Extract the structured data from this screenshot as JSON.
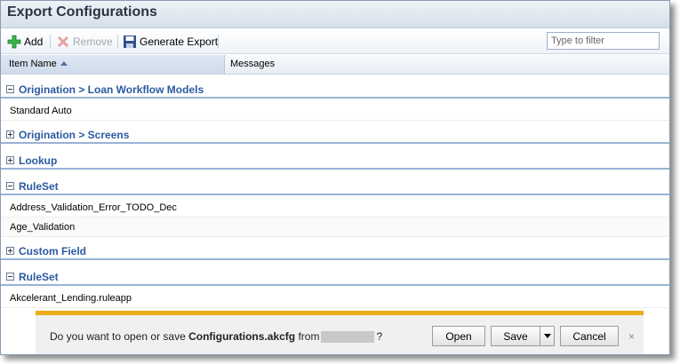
{
  "window": {
    "title": "Export Configurations"
  },
  "toolbar": {
    "add_label": "Add",
    "remove_label": "Remove",
    "generate_label": "Generate Export",
    "filter_placeholder": "Type to filter"
  },
  "columns": {
    "item_name": "Item Name",
    "messages": "Messages"
  },
  "groups": [
    {
      "label": "Origination > Loan Workflow Models",
      "expanded": true,
      "items": [
        "Standard Auto"
      ]
    },
    {
      "label": "Origination > Screens",
      "expanded": false,
      "items": []
    },
    {
      "label": "Lookup",
      "expanded": false,
      "items": []
    },
    {
      "label": "RuleSet",
      "expanded": true,
      "items": [
        "Address_Validation_Error_TODO_Dec",
        "Age_Validation"
      ]
    },
    {
      "label": "Custom Field",
      "expanded": false,
      "items": []
    },
    {
      "label": "RuleSet",
      "expanded": true,
      "items": [
        "Akcelerant_Lending.ruleapp"
      ]
    }
  ],
  "notification": {
    "prefix": "Do you want to open or save",
    "filename": "Configurations.akcfg",
    "from": "from",
    "suffix": "?",
    "open_label": "Open",
    "save_label": "Save",
    "cancel_label": "Cancel",
    "close_glyph": "×"
  },
  "colors": {
    "accent": "#2b5aa0",
    "notification_bar": "#ecac17"
  }
}
